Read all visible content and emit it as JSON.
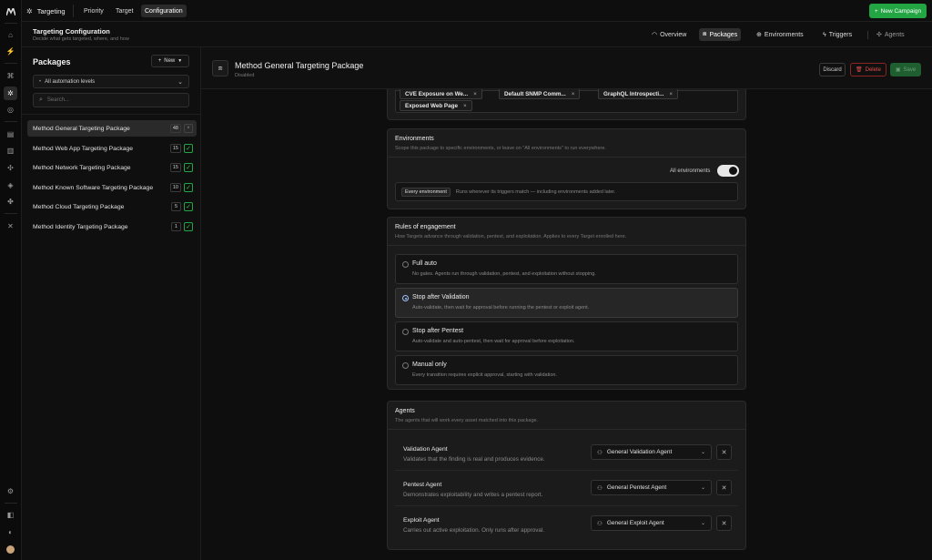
{
  "topbar": {
    "brand_label": "Targeting",
    "tabs": [
      {
        "label": "Priority"
      },
      {
        "label": "Target"
      },
      {
        "label": "Configuration"
      }
    ],
    "new_campaign": "New Campaign"
  },
  "header": {
    "title": "Targeting Configuration",
    "subtitle": "Decide what gets targeted, where, and how",
    "tabs": [
      {
        "label": "Overview",
        "icon": "gauge-icon"
      },
      {
        "label": "Packages",
        "icon": "cube-icon"
      },
      {
        "label": "Environments",
        "icon": "globe-icon"
      },
      {
        "label": "Triggers",
        "icon": "bolt-icon"
      },
      {
        "label": "Agents",
        "icon": "agent-icon"
      }
    ]
  },
  "packages": {
    "title": "Packages",
    "new_label": "New",
    "filter_value": "All automation levels",
    "search_placeholder": "Search...",
    "items": [
      {
        "name": "Method General Targeting Package",
        "count": "48"
      },
      {
        "name": "Method Web App Targeting Package",
        "count": "15"
      },
      {
        "name": "Method Network Targeting Package",
        "count": "15"
      },
      {
        "name": "Method Known Software Targeting Package",
        "count": "10"
      },
      {
        "name": "Method Cloud Targeting Package",
        "count": "5"
      },
      {
        "name": "Method Identity Targeting Package",
        "count": "1"
      }
    ]
  },
  "detail": {
    "title": "Method General Targeting Package",
    "status": "Disabled",
    "discard": "Discard",
    "delete": "Delete",
    "save": "Save"
  },
  "triggers": {
    "tags": [
      "CVE Exposure on We...",
      "Default SNMP Comm...",
      "GraphQL Introspecti...",
      "Exposed Web Page"
    ]
  },
  "environments": {
    "title": "Environments",
    "subtitle": "Scope this package to specific environments, or leave on \"All environments\" to run everywhere.",
    "toggle_label": "All environments",
    "toggle_on": true,
    "badge": "Every environment",
    "badge_text": "Runs wherever its triggers match — including environments added later."
  },
  "rules": {
    "title": "Rules of engagement",
    "subtitle": "How Targets advance through validation, pentest, and exploitation. Applies to every Target enrolled here.",
    "options": [
      {
        "title": "Full auto",
        "desc": "No gates. Agents run through validation, pentest, and exploitation without stopping."
      },
      {
        "title": "Stop after Validation",
        "desc": "Auto-validate, then wait for approval before running the pentest or exploit agent."
      },
      {
        "title": "Stop after Pentest",
        "desc": "Auto-validate and auto-pentest, then wait for approval before exploitation."
      },
      {
        "title": "Manual only",
        "desc": "Every transition requires explicit approval, starting with validation."
      }
    ],
    "selected": "Stop after Validation"
  },
  "agents": {
    "title": "Agents",
    "subtitle": "The agents that will work every asset matched into this package.",
    "rows": [
      {
        "name": "Validation Agent",
        "desc": "Validates that the finding is real and produces evidence.",
        "value": "General Validation Agent"
      },
      {
        "name": "Pentest Agent",
        "desc": "Demonstrates exploitability and writes a pentest report.",
        "value": "General Pentest Agent"
      },
      {
        "name": "Exploit Agent",
        "desc": "Carries out active exploitation. Only runs after approval.",
        "value": "General Exploit Agent"
      }
    ]
  },
  "colors": {
    "accent_green": "#23a543",
    "danger_red": "#e24d4d",
    "radio_selected": "#9ec0ff"
  }
}
